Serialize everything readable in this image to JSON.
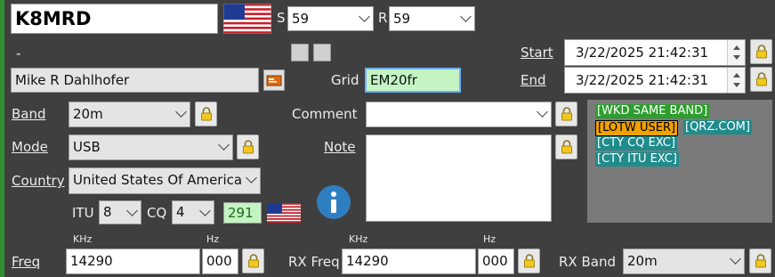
{
  "header": {
    "callsign": "K8MRD",
    "s_label": "S",
    "s_value": "59",
    "r_label": "R",
    "r_value": "59",
    "dash": "-",
    "start_label": "Start",
    "start_value": "3/22/2025 21:42:31",
    "end_label": "End",
    "end_value": "3/22/2025 21:42:31"
  },
  "contact": {
    "name": "Mike R Dahlhofer",
    "grid_label": "Grid",
    "grid_value": "EM20fr",
    "comment_label": "Comment",
    "comment_value": "",
    "note_label": "Note",
    "note_value": ""
  },
  "band": {
    "label": "Band",
    "value": "20m"
  },
  "mode": {
    "label": "Mode",
    "value": "USB"
  },
  "country": {
    "label": "Country",
    "value": "United States Of America"
  },
  "zones": {
    "itu_label": "ITU",
    "itu_value": "8",
    "cq_label": "CQ",
    "cq_value": "4",
    "dxcc": "291"
  },
  "badges": [
    {
      "text": "[WKD SAME BAND]",
      "bg": "#2e9e2e"
    },
    {
      "text": "[LOTW USER]",
      "bg": "#f0a000"
    },
    {
      "text": "[QRZ.COM]",
      "bg": "#1f8c8c"
    },
    {
      "text": "[CTY CQ EXC]",
      "bg": "#1f8c8c"
    },
    {
      "text": "[CTY ITU EXC]",
      "bg": "#1f8c8c"
    }
  ],
  "freq": {
    "khz_label": "KHz",
    "hz_label": "Hz",
    "label": "Freq",
    "khz_value": "14290",
    "hz_value": "000",
    "rx_label": "RX Freq",
    "rx_khz_value": "14290",
    "rx_hz_value": "000",
    "rx_band_label": "RX Band",
    "rx_band_value": "20m"
  },
  "icons": {
    "flag": "us-flag-icon",
    "lock": "padlock-icon",
    "info": "info-icon",
    "qsl": "qsl-card-icon"
  }
}
